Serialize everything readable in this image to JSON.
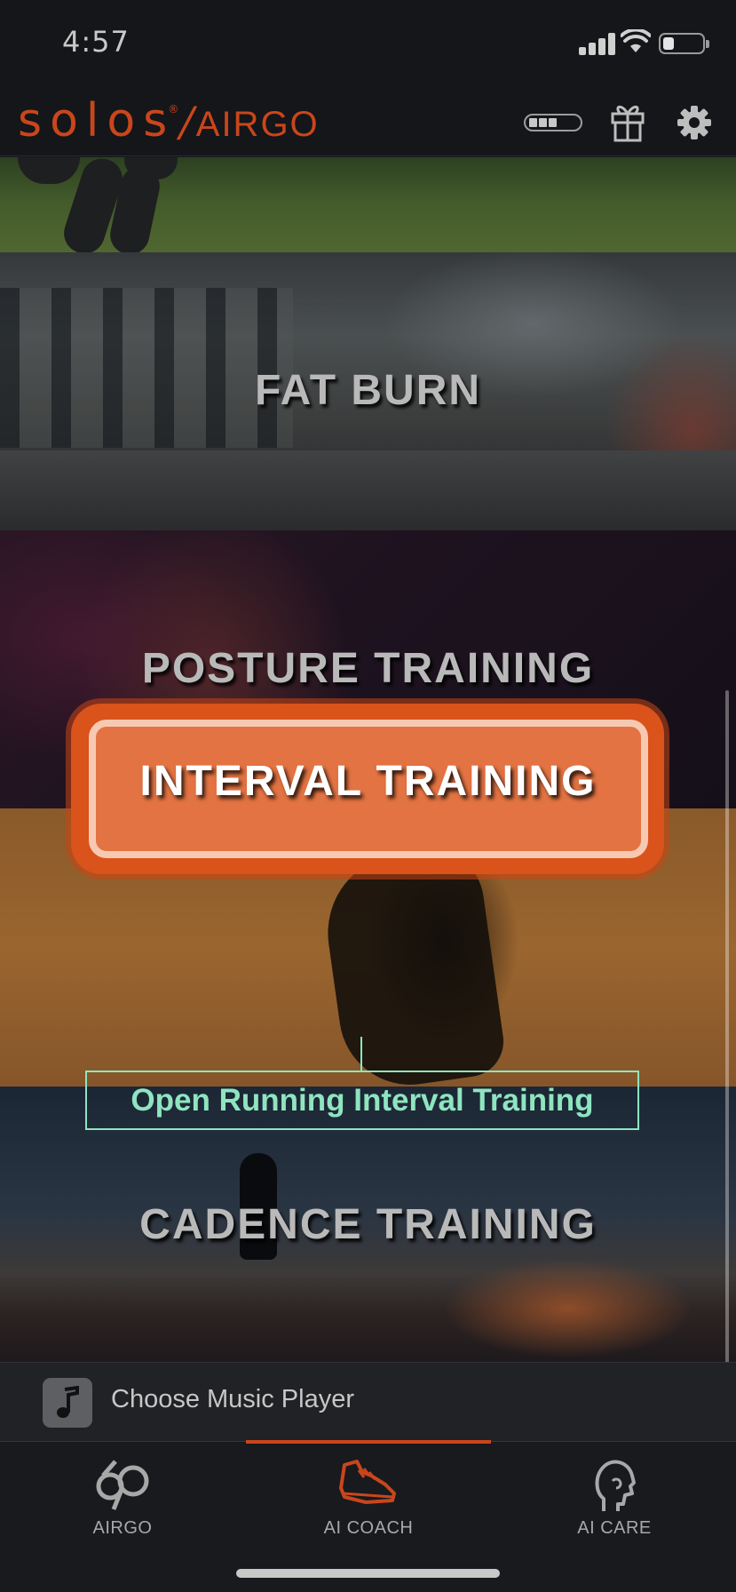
{
  "status_bar": {
    "time": "4:57"
  },
  "header": {
    "logo_brand": "solos",
    "logo_reg": "®",
    "logo_slash": "/",
    "logo_product": "AIRGO"
  },
  "workouts": [
    {
      "label": "FAT BURN"
    },
    {
      "label": "POSTURE TRAINING"
    },
    {
      "label": "INTERVAL TRAINING"
    },
    {
      "label": "CADENCE TRAINING"
    }
  ],
  "callout": {
    "text": "Open Running Interval Training"
  },
  "music": {
    "label": "Choose Music Player"
  },
  "tabs": [
    {
      "label": "AIRGO",
      "icon": "airgo-glasses-icon"
    },
    {
      "label": "AI COACH",
      "icon": "running-shoe-icon",
      "active": true
    },
    {
      "label": "AI CARE",
      "icon": "head-profile-icon"
    }
  ],
  "colors": {
    "accent": "#c9461c",
    "callout": "#8ee5c0",
    "background": "#141619"
  }
}
